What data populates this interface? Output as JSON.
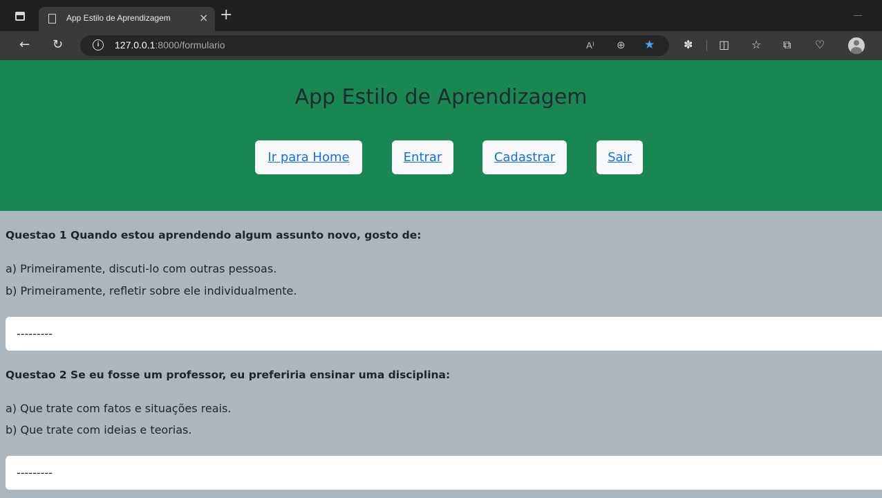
{
  "browser": {
    "tab_title": "App Estilo de Aprendizagem",
    "tab_close": "×",
    "new_tab": "+",
    "url_host": "127.0.0.1",
    "url_rest": ":8000/formulario",
    "read_aloud": "A⁾",
    "zoom_icon": "⊕"
  },
  "header": {
    "title": "App Estilo de Aprendizagem",
    "nav": [
      {
        "label": "Ir para Home"
      },
      {
        "label": "Entrar"
      },
      {
        "label": "Cadastrar"
      },
      {
        "label": "Sair"
      }
    ]
  },
  "questions": [
    {
      "title": "Questao 1 Quando estou aprendendo algum assunto novo, gosto de:",
      "options": [
        "a) Primeiramente, discuti-lo com outras pessoas.",
        "b) Primeiramente, refletir sobre ele individualmente."
      ],
      "selected": "---------"
    },
    {
      "title": "Questao 2 Se eu fosse um professor, eu preferiria ensinar uma disciplina:",
      "options": [
        "a) Que trate com fatos e situações reais.",
        "b) Que trate com ideias e teorias."
      ],
      "selected": "---------"
    }
  ],
  "colors": {
    "header_bg": "#198754",
    "content_bg": "#adb5bd",
    "link": "#0d6efd"
  }
}
